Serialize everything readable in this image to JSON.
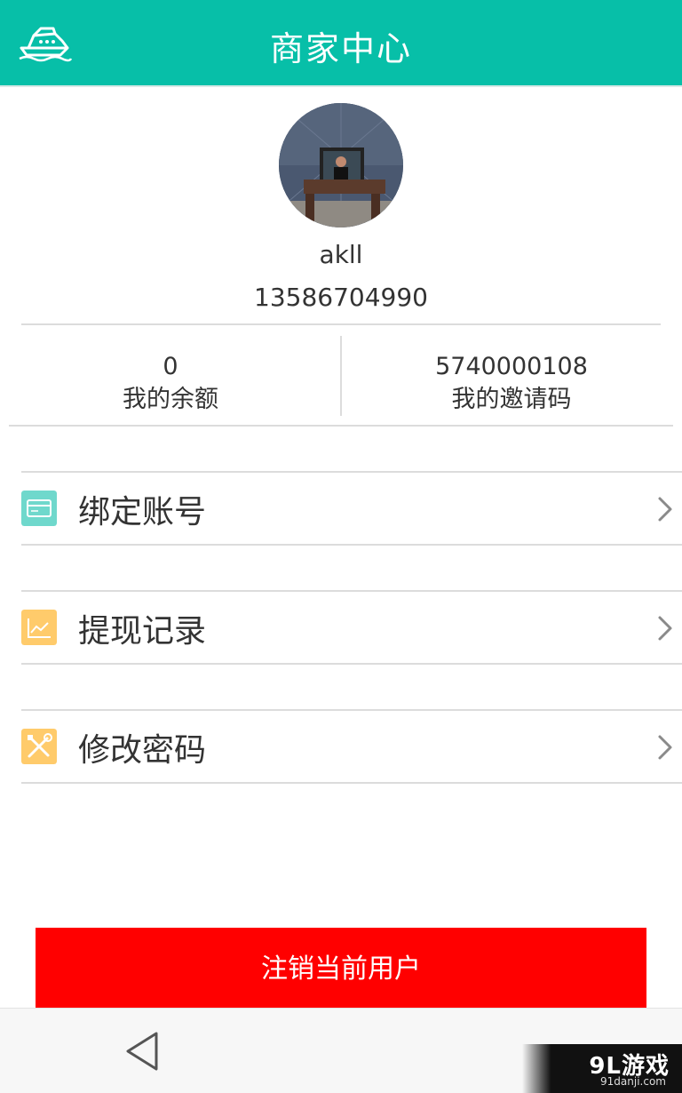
{
  "header": {
    "title": "商家中心",
    "logo_icon": "boat-icon"
  },
  "profile": {
    "username": "akll",
    "phone": "13586704990"
  },
  "stats": [
    {
      "value": "0",
      "label": "我的余额"
    },
    {
      "value": "5740000108",
      "label": "我的邀请码"
    }
  ],
  "menu": [
    {
      "label": "绑定账号",
      "icon": "card-icon",
      "icon_color": "#6fd8cc"
    },
    {
      "label": "提现记录",
      "icon": "chart-icon",
      "icon_color": "#ffcb6b"
    },
    {
      "label": "修改密码",
      "icon": "tools-icon",
      "icon_color": "#ffcb6b"
    }
  ],
  "logout_label": "注销当前用户",
  "colors": {
    "header": "#07bfa8",
    "logout": "#ff0000"
  },
  "watermark": {
    "title": "9L游戏",
    "site": "91danji.com"
  }
}
